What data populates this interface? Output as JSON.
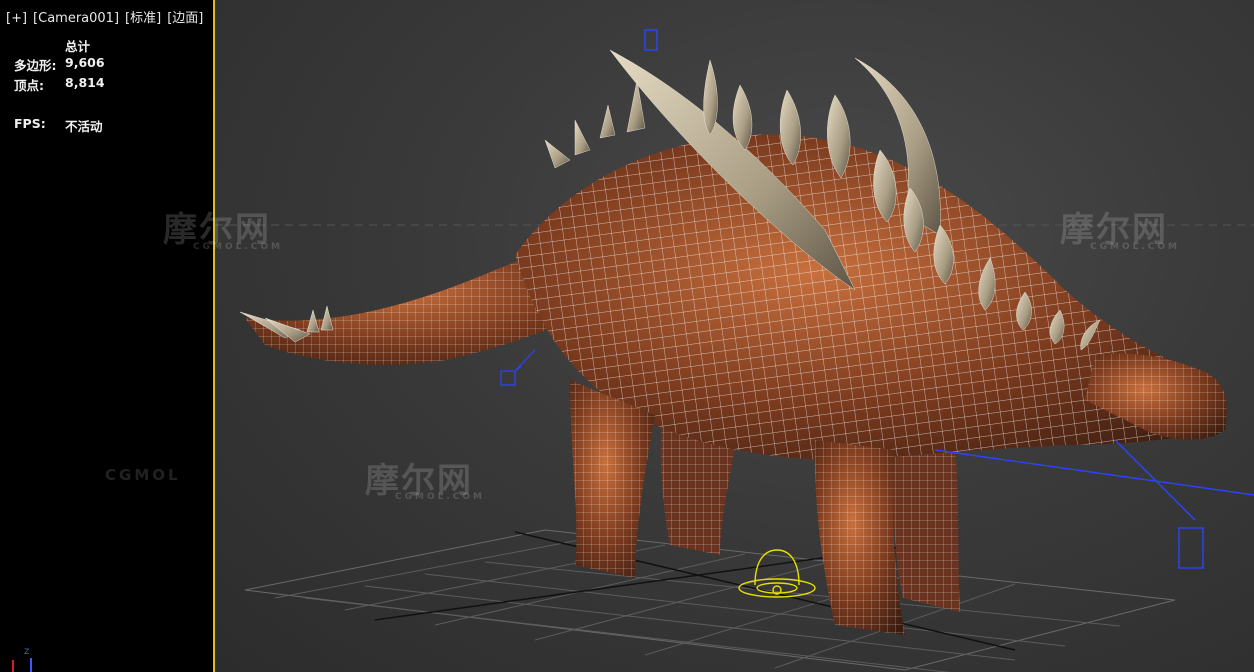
{
  "viewport": {
    "menu_button": "[+]",
    "camera": "[Camera001]",
    "shading": "[标准]",
    "display": "[边面]"
  },
  "stats": {
    "header": "总计",
    "polygons_label": "多边形:",
    "polygons_value": "9,606",
    "vertices_label": "顶点:",
    "vertices_value": "8,814",
    "fps_label": "FPS:",
    "fps_value": "不活动"
  },
  "watermark": {
    "text": "摩尔网",
    "sub": "CGMOL.COM",
    "brand": "CGMOL"
  },
  "axis": {
    "z": "z"
  },
  "colors": {
    "viewport_border": "#d8c020",
    "grid": "#5a5a5a",
    "wire": "#ffffff",
    "skin_dark": "#4a2414",
    "skin_light": "#c8703e",
    "plate": "#bfb49a",
    "light_gizmo": "#e8e000",
    "camera_gizmo": "#1e3cff"
  },
  "icons": [
    "camera-gizmo-icon",
    "light-gizmo-icon",
    "target-box-icon",
    "axis-tripod-icon"
  ]
}
